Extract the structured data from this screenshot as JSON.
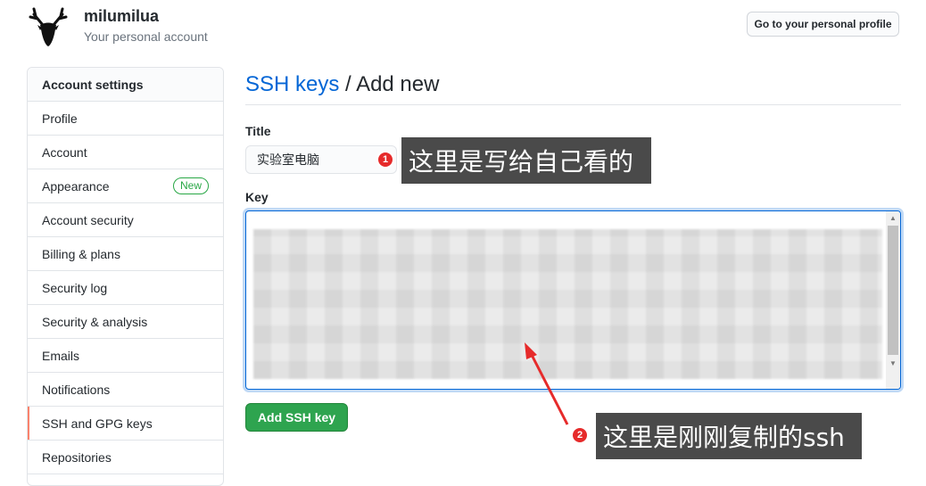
{
  "user": {
    "name": "milumilua",
    "subtitle": "Your personal account",
    "profile_button": "Go to your personal profile"
  },
  "sidebar": {
    "header": "Account settings",
    "items": [
      {
        "label": "Profile"
      },
      {
        "label": "Account"
      },
      {
        "label": "Appearance",
        "badge": "New"
      },
      {
        "label": "Account security"
      },
      {
        "label": "Billing & plans"
      },
      {
        "label": "Security log"
      },
      {
        "label": "Security & analysis"
      },
      {
        "label": "Emails"
      },
      {
        "label": "Notifications"
      },
      {
        "label": "SSH and GPG keys",
        "selected": true
      },
      {
        "label": "Repositories"
      }
    ]
  },
  "page": {
    "breadcrumb": "SSH keys",
    "separator": " / ",
    "title": "Add new"
  },
  "form": {
    "title_label": "Title",
    "title_value": "实验室电脑",
    "key_label": "Key",
    "submit_label": "Add SSH key"
  },
  "annotations": [
    {
      "number": "1",
      "text": "这里是写给自己看的"
    },
    {
      "number": "2",
      "text": "这里是刚刚复制的ssh"
    }
  ],
  "colors": {
    "link": "#0366d6",
    "primary_button": "#2ea44f",
    "selected_marker": "#f9826c",
    "badge": "#28a745",
    "annotation_marker": "#e62b2b",
    "annotation_box": "#4a4a4a"
  }
}
